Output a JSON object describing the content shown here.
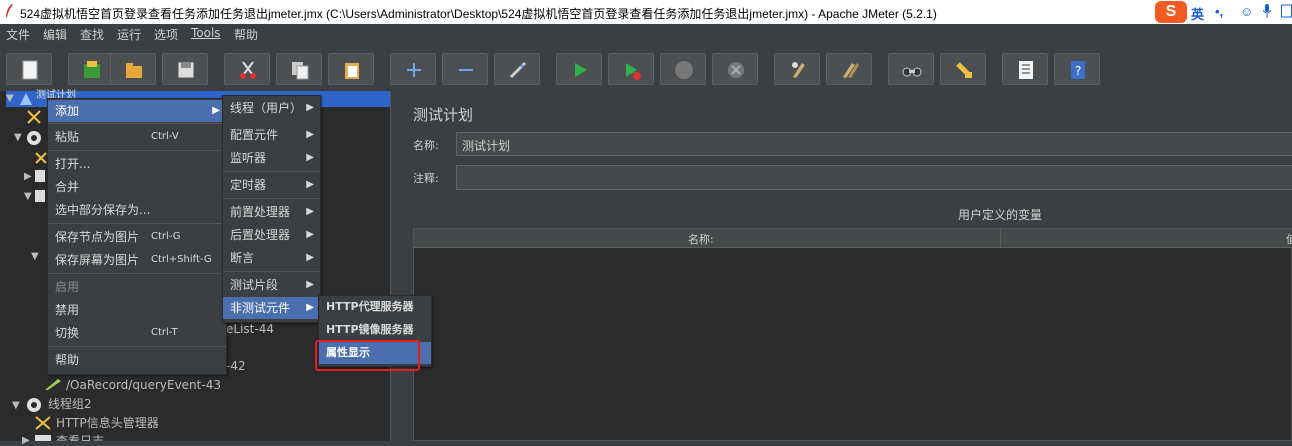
{
  "window": {
    "title": "524虚拟机悟空首页登录查看任务添加任务退出jmeter.jmx (C:\\Users\\Administrator\\Desktop\\524虚拟机悟空首页登录查看任务添加任务退出jmeter.jmx) - Apache JMeter (5.2.1)"
  },
  "ime": {
    "logo": "S",
    "lang": "英",
    "punct": "•,",
    "emoji": "☺",
    "mic": "🎙"
  },
  "menubar": [
    "文件",
    "编辑",
    "查找",
    "运行",
    "选项",
    "Tools",
    "帮助"
  ],
  "toolbar": {
    "icons": [
      "new-icon",
      "templates-icon",
      "open-icon",
      "save-icon",
      "cut-icon",
      "copy-icon",
      "paste-icon",
      "expand-icon",
      "collapse-icon",
      "toggle-icon",
      "start-icon",
      "start-no-pause-icon",
      "stop-icon",
      "shutdown-icon",
      "clear-icon",
      "clear-all-icon",
      "search-icon",
      "reset-search-icon",
      "function-helper-icon",
      "help-icon"
    ],
    "colors": {
      "accent": "#4b6eaf",
      "run_green": "#2fb24a"
    }
  },
  "tree": {
    "root_label": "测试计划",
    "visible_rows": [
      {
        "text": "eList-44"
      },
      {
        "text": "-42"
      },
      {
        "text": "/OaRecord/queryEvent-43"
      },
      {
        "text": "线程组2"
      },
      {
        "text": "HTTP信息头管理器"
      },
      {
        "text": "查看日志"
      }
    ]
  },
  "context_menu": {
    "items": [
      {
        "label": "添加",
        "accel": "",
        "submenu": true,
        "selected": true
      },
      {
        "label": "粘贴",
        "accel": "Ctrl-V"
      },
      {
        "label": "打开..."
      },
      {
        "label": "合并"
      },
      {
        "label": "选中部分保存为..."
      },
      {
        "label": "保存节点为图片",
        "accel": "Ctrl-G"
      },
      {
        "label": "保存屏幕为图片",
        "accel": "Ctrl+Shift-G"
      },
      {
        "label": "启用",
        "disabled": true
      },
      {
        "label": "禁用"
      },
      {
        "label": "切换",
        "accel": "Ctrl-T"
      },
      {
        "label": "帮助"
      }
    ]
  },
  "add_submenu": {
    "items": [
      {
        "label": "线程（用户）"
      },
      {
        "label": "配置元件"
      },
      {
        "label": "监听器"
      },
      {
        "label": "定时器"
      },
      {
        "label": "前置处理器"
      },
      {
        "label": "后置处理器"
      },
      {
        "label": "断言"
      },
      {
        "label": "测试片段"
      },
      {
        "label": "非测试元件",
        "selected": true
      }
    ]
  },
  "nontest_submenu": {
    "items": [
      {
        "label": "HTTP代理服务器"
      },
      {
        "label": "HTTP镜像服务器"
      },
      {
        "label": "属性显示",
        "selected": true
      }
    ]
  },
  "plan_panel": {
    "title": "测试计划",
    "name_label": "名称:",
    "name_value": "测试计划",
    "comment_label": "注释:",
    "comment_value": "",
    "vars_caption": "用户定义的变量",
    "table_headers": [
      "名称:",
      "值"
    ]
  }
}
